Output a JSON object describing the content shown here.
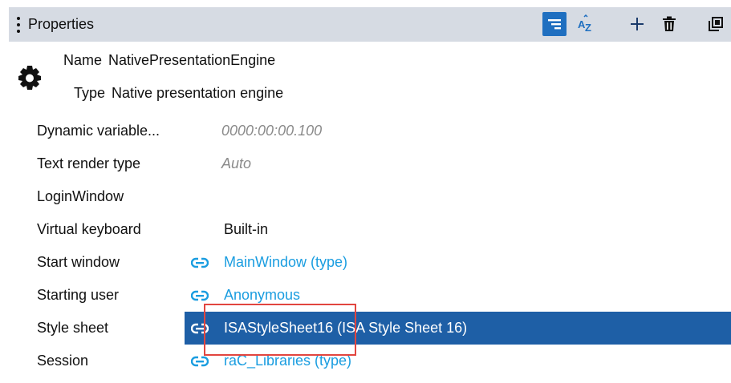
{
  "header": {
    "title": "Properties",
    "buttons": [
      {
        "icon": "categorized-view-icon",
        "active": true
      },
      {
        "icon": "sort-az-icon"
      },
      {
        "icon": "plus-icon"
      },
      {
        "icon": "trash-icon"
      },
      {
        "icon": "popout-icon"
      }
    ]
  },
  "summary": {
    "icon": "gear-icon",
    "name_label": "Name",
    "name_value": "NativePresentationEngine",
    "type_label": "Type",
    "type_value": "Native presentation engine"
  },
  "properties": [
    {
      "name": "Dynamic variable...",
      "value": "0000:00:00.100",
      "style": "muted"
    },
    {
      "name": "Text render type",
      "value": "Auto",
      "style": "muted"
    },
    {
      "name": "LoginWindow",
      "value": "",
      "style": "plain"
    },
    {
      "name": "Virtual keyboard",
      "value": "Built-in",
      "style": "plain"
    },
    {
      "name": "Start window",
      "value": "MainWindow (type)",
      "style": "link"
    },
    {
      "name": "Starting user",
      "value": "Anonymous",
      "style": "link"
    },
    {
      "name": "Style sheet",
      "value": "ISAStyleSheet16 (ISA Style Sheet 16)",
      "style": "link",
      "selected": true
    },
    {
      "name": "Session",
      "value": "raC_Libraries (type)",
      "style": "link"
    }
  ],
  "colors": {
    "header_bg": "#d6dbe3",
    "accent": "#1f6fc0",
    "selection": "#1e5fa6",
    "link": "#1a9de0",
    "highlight": "#e2453f"
  }
}
